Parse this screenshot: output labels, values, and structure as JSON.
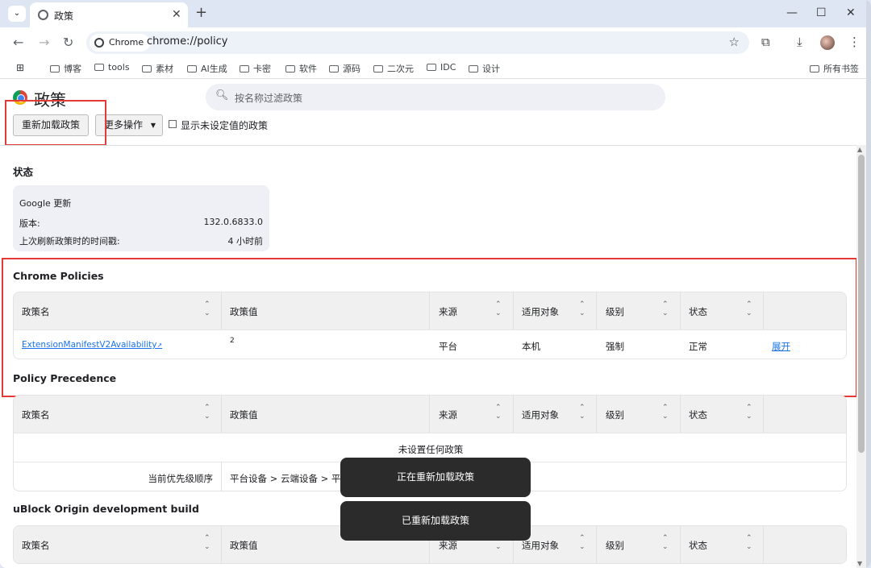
{
  "tab": {
    "title": "政策"
  },
  "toolbar": {
    "chip": "Chrome",
    "url": "chrome://policy"
  },
  "bookmarks": [
    "博客",
    "tools",
    "素材",
    "AI生成",
    "卡密",
    "软件",
    "源码",
    "二次元",
    "IDC",
    "设计"
  ],
  "bookmarks_right": "所有书签",
  "page": {
    "title": "政策",
    "search_placeholder": "按名称过滤政策",
    "reload_button": "重新加载政策",
    "more_actions": "更多操作",
    "show_unset": "显示未设定值的政策"
  },
  "status": {
    "heading": "状态",
    "card_title": "Google 更新",
    "version_label": "版本:",
    "version_value": "132.0.6833.0",
    "refresh_label": "上次刷新政策时的时间戳:",
    "refresh_value": "4 小时前"
  },
  "columns": [
    "政策名",
    "政策值",
    "来源",
    "适用对象",
    "级别",
    "状态"
  ],
  "chrome_policies": {
    "heading": "Chrome Policies",
    "rows": [
      {
        "name": "ExtensionManifestV2Availability",
        "value": "2",
        "source": "平台",
        "scope": "本机",
        "level": "强制",
        "status": "正常",
        "action": "展开"
      }
    ]
  },
  "precedence": {
    "heading": "Policy Precedence",
    "empty": "未设置任何政策",
    "order_label": "当前优先级顺序",
    "order_value": "平台设备 > 云端设备 > 平台用户"
  },
  "ublock": {
    "heading": "uBlock Origin development build"
  },
  "toasts": [
    "正在重新加载政策",
    "已重新加载政策"
  ]
}
